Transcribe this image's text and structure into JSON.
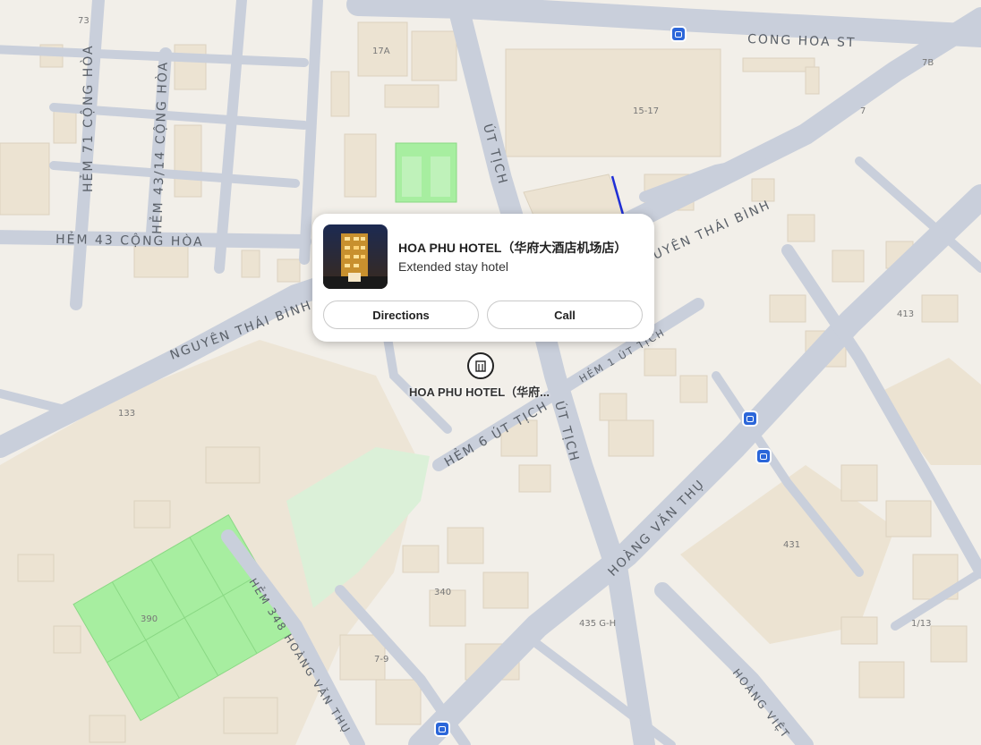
{
  "map": {
    "streets": {
      "cong_hoa_st": "CONG HOA ST",
      "hem_71_cong_hoa": "HẺM 71 CỘNG HÒA",
      "hem_43_14_cong_hoa": "HẺM 43/14 CỘNG HÒA",
      "hem_43_cong_hoa": "HẺM 43 CỘNG HÒA",
      "nguyen_thai_binh_left": "NGUYÊN THÁI BÌNH",
      "nguyen_thai_binh_right": "UYÊN THÁI BÌNH",
      "ut_tich_north": "ÚT TỊCH",
      "ut_tich_south": "ÚT TỊCH",
      "hem_1_ut_tich": "HẺM 1 ÚT TỊCH",
      "hem_6_ut_tich": "HẺM 6 ÚT TỊCH",
      "hoang_van_thu": "HOÀNG VĂN THỤ",
      "hem_348_hoang_van_thu": "HẺM 348 HOÀNG VĂN THỤ",
      "hoang_viet": "HOÀNG VIỆT"
    },
    "numbers": {
      "n73": "73",
      "n17a": "17A",
      "n15_17": "15-17",
      "n7": "7",
      "n7b": "7B",
      "n413": "413",
      "n133": "133",
      "n431": "431",
      "n340": "340",
      "n390": "390",
      "n435gh": "435 G-H",
      "n7_9": "7-9",
      "n1_13": "1/13"
    },
    "icons": [
      "bus-stop-icon",
      "building-icon",
      "hotel-photo"
    ],
    "colors": {
      "background": "#f2efe9",
      "road": "#c9cfdb",
      "building": "#ece3d2",
      "park": "#cdeccd",
      "sports_field": "#a7eea0",
      "bus_stop": "#2b66d9"
    }
  },
  "popup": {
    "title": "HOA PHU HOTEL（华府大酒店机场店）",
    "subtitle": "Extended stay hotel",
    "directions_label": "Directions",
    "call_label": "Call"
  },
  "marker": {
    "label": "HOA PHU HOTEL（华府..."
  }
}
